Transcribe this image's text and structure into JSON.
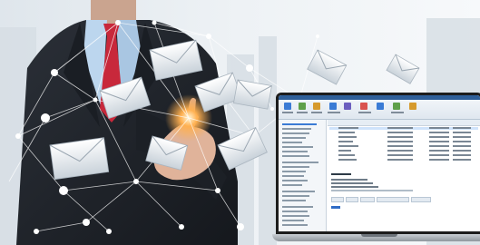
{
  "scene": {
    "description_free": true
  },
  "icons": [
    "envelope-icon",
    "laptop-icon",
    "hand-icon"
  ],
  "colors": {
    "suit": "#1f2329",
    "tie": "#c8283b",
    "shirt": "#bcd6ee",
    "glow": "#ffb050",
    "app_accent": "#2f5f99"
  }
}
